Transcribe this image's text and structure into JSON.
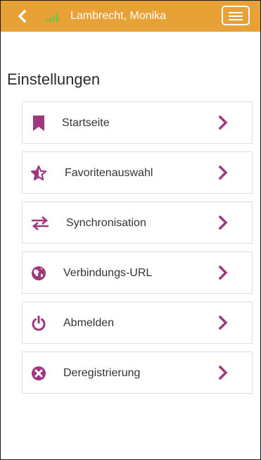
{
  "header": {
    "back_icon": "chevron-left-icon",
    "signal_icon": "signal-strength-icon",
    "user_name": "Lambrecht, Monika",
    "menu_icon": "hamburger-menu-icon",
    "background_color": "#e8a136"
  },
  "page": {
    "title": "Einstellungen"
  },
  "settings": {
    "accent_color": "#a0387f",
    "items": [
      {
        "label": "Startseite",
        "icon": "bookmark-icon"
      },
      {
        "label": "Favoritenauswahl",
        "icon": "star-icon"
      },
      {
        "label": "Synchronisation",
        "icon": "sync-arrows-icon"
      },
      {
        "label": "Verbindungs-URL",
        "icon": "globe-icon"
      },
      {
        "label": "Abmelden",
        "icon": "power-icon"
      },
      {
        "label": "Deregistrierung",
        "icon": "remove-circle-icon"
      }
    ]
  }
}
